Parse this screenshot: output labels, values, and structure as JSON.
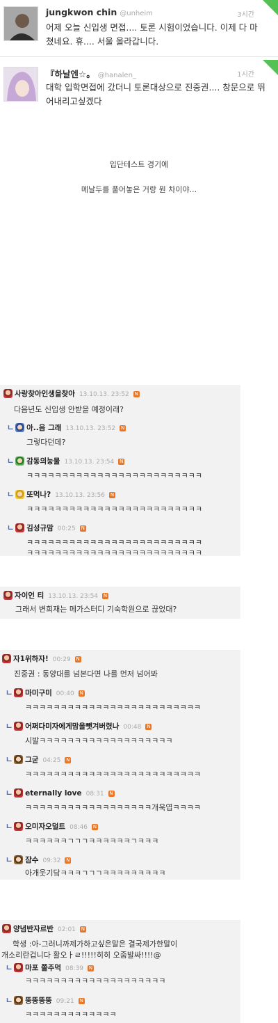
{
  "tweets": [
    {
      "name": "jungkwon chin",
      "handle": "@unheim",
      "time": "3시간",
      "text": "어제 오늘 신입생 면접.... 토론 시험이었습니다. 이제 다 마쳤네요. 휴.... 서울 올라갑니다."
    },
    {
      "name": "『하날엔☆。",
      "handle": "@hanalen_",
      "time": "1시간",
      "text": "대학 입학면접에 갔더니 토론대상으로 진중권.... 창문으로 뛰어내리고싶겠다"
    }
  ],
  "caption": {
    "line1": "입단테스트 경기에",
    "line2": "메날두를 풀어놓은 거랑 뭔 차이야..."
  },
  "block1": {
    "main": {
      "nick": "사랑찾아인생을찾아",
      "date": "13.10.13. 23:52",
      "text": "다음년도 신입생 안받을 예정이래?"
    },
    "replies": [
      {
        "nick": "아..음 그래",
        "date": "13.10.13. 23:52",
        "lines": [
          "그렇다던데?"
        ]
      },
      {
        "nick": "감동의눙물",
        "date": "13.10.13. 23:54",
        "lines": [
          "ㅋㅋㅋㅋㅋㅋㅋㅋㅋㅋㅋㅋㅋㅋㅋㅋㅋㅋㅋㅋㅋㅋㅋㅋㅋ"
        ]
      },
      {
        "nick": "또먹나?",
        "date": "13.10.13. 23:56",
        "lines": [
          "ㅋㅋㅋㅋㅋㅋㅋㅋㅋㅋㅋㅋㅋㅋㅋㅋㅋㅋㅋㅋㅋㅋㅋㅋㅋ"
        ]
      },
      {
        "nick": "김성규맘",
        "date": "00:25",
        "lines": [
          "ㅋㅋㅋㅋㅋㅋㅋㅋㅋㅋㅋㅋㅋㅋㅋㅋㅋㅋㅋㅋㅋㅋㅋㅋㅋ",
          "ㅋㅋㅋㅋㅋㅋㅋㅋㅋㅋㅋㅋㅋㅋㅋㅋㅋㅋㅋㅋㅋㅋㅋㅋㅋ"
        ]
      }
    ]
  },
  "block2": {
    "main": {
      "nick": "자이언 티",
      "date": "13.10.13. 23:54",
      "text": "그래서 변희재는 메가스터디 기숙학원으로 끊었대?"
    }
  },
  "block3": {
    "main": {
      "nick": "자1위하자!",
      "date": "00:29",
      "text": "진중권 : 동양대를 넘본다면 나를 먼저 넘어봐"
    },
    "replies": [
      {
        "nick": "마미구미",
        "date": "00:40",
        "lines": [
          "ㅋㅋㅋㅋㅋㅋㅋㅋㅋㅋㅋㅋㅋㅋㅋㅋㅋㅋㅋㅋㅋㅋㅋㅋㅋ"
        ]
      },
      {
        "nick": "어쩌다미자에게맘을뺏겨버렸나",
        "date": "00:48",
        "lines": [
          "시발ㅋㅋㅋㅋㅋㅋㅋㅋㅋㅋㅋㅋㅋㅋㅋㅋㅋㅋㅋ"
        ]
      },
      {
        "nick": "그굳",
        "date": "04:25",
        "lines": [
          "ㅋㅋㅋㅋㅋㅋㅋㅋㅋㅋㅋㅋㅋㅋㅋㅋㅋㅋㅋㅋㅋㅋㅋㅋㅋ"
        ]
      },
      {
        "nick": "eternally love",
        "date": "08:31",
        "lines": [
          "ㅋㅋㅋㅋㅋㅋㅋㅋㅋㅋㅋㅋㅋㅋㅋㅋㅋㅋ개욱엽ㅋㅋㅋㅋ"
        ]
      },
      {
        "nick": "오미자오덜트",
        "date": "08:46",
        "lines": [
          "ㅋㅋㅋㅋㅋㅋㄱㄱㄱㅋㅋㅋㅋㅋㅋㄱㅋㅋㅋ"
        ]
      },
      {
        "nick": "잠수",
        "date": "09:32",
        "lines": [
          "아개웃기닼ㅋㅋㅋㄱㄱㄱㅋㅋㅋㅋㅋㅋㅋㅋㅋ"
        ]
      }
    ]
  },
  "block4": {
    "main": {
      "nick": "양념반자르반",
      "date": "02:01",
      "lines": [
        "학생 :아-그러니까제가하고싶은말은 결국제가한말이",
        "개소리란겁니다 활오ㅏㄹ!!!!!히히 오줌발싸!!!!@"
      ]
    },
    "replies": [
      {
        "nick": "마포 쫄주먹",
        "date": "08:39",
        "lines": [
          "ㅋㅋㅋㅋㅋㅋㅋㅋㅋㅋㅋㅋㅋㅋㅋㅋㅋㅋㅋㅋ"
        ]
      },
      {
        "nick": "뚱뚱뚱뚱",
        "date": "09:21",
        "lines": [
          "ㅋㅋㅋㅋㅋㅋㅋㅋㅋㅋㅋㅋㅋ"
        ]
      }
    ]
  },
  "new_badge": "N"
}
